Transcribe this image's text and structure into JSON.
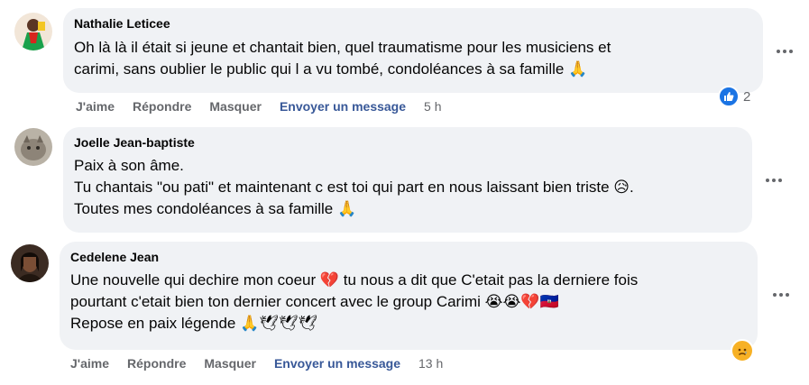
{
  "comments": [
    {
      "author": "Nathalie Leticee",
      "lines": [
        "Oh là là il était si jeune et chantait bien, quel traumatisme pour les musiciens et",
        "carimi, sans oublier le public qui l a vu tombé, condoléances à sa famille 🙏"
      ],
      "actions": {
        "like": "J'aime",
        "reply": "Répondre",
        "hide": "Masquer",
        "message": "Envoyer un message",
        "time": "5 h"
      },
      "reaction_count": "2"
    },
    {
      "author": "Joelle Jean-baptiste",
      "lines": [
        "Paix à son âme.",
        "Tu chantais \"ou pati\" et maintenant c est toi qui part en nous laissant bien triste 😥.",
        "Toutes mes condoléances à sa famille 🙏"
      ]
    },
    {
      "author": "Cedelene Jean",
      "lines": [
        "Une nouvelle qui dechire mon coeur 💔 tu nous a dit que C'etait pas la derniere fois",
        "pourtant c'etait bien ton dernier concert avec le group Carimi 😭😭💔🇭🇹",
        "Repose en paix légende 🙏🕊🕊🕊"
      ],
      "actions": {
        "like": "J'aime",
        "reply": "Répondre",
        "hide": "Masquer",
        "message": "Envoyer un message",
        "time": "13 h"
      }
    }
  ],
  "icons": {
    "more": "more-options-icon",
    "like": "like-reaction-icon",
    "sad": "sad-reaction-icon"
  },
  "colors": {
    "bubble": "#f0f2f5",
    "link": "#385898",
    "like": "#1b74e4"
  }
}
